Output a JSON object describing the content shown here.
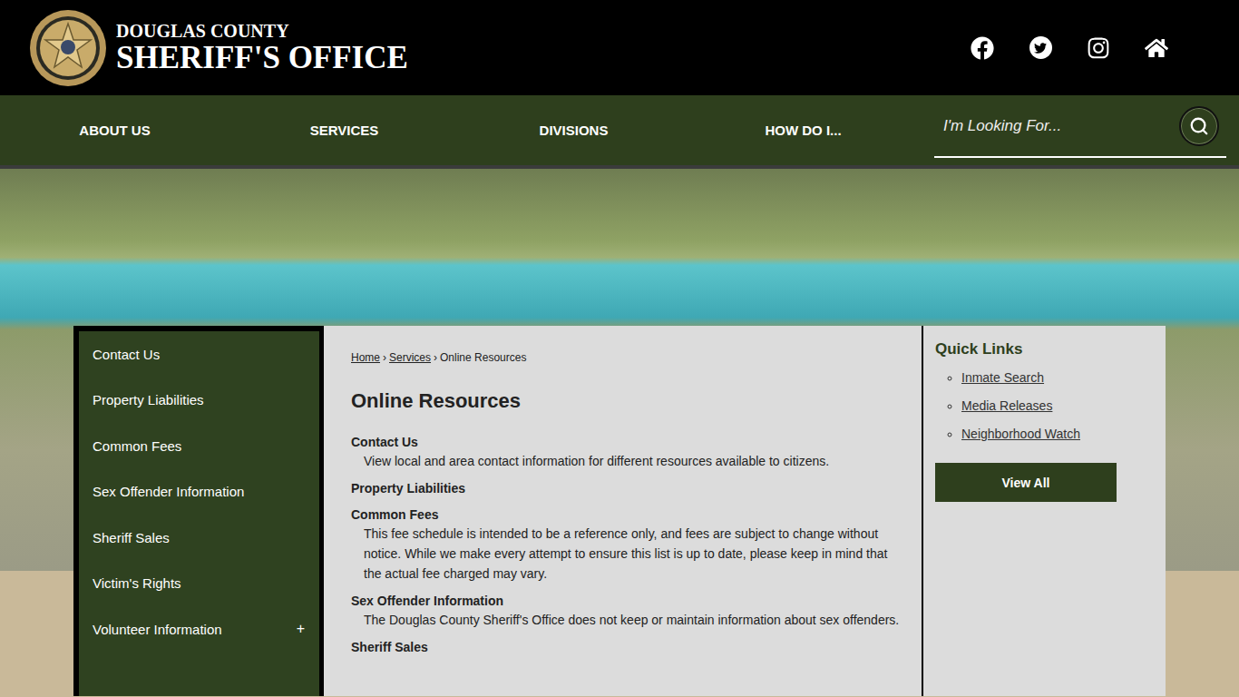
{
  "header": {
    "agency_line": "DOUGLAS COUNTY",
    "office_line": "SHERIFF'S OFFICE",
    "social": [
      {
        "kind": "facebook"
      },
      {
        "kind": "twitter"
      },
      {
        "kind": "instagram"
      },
      {
        "kind": "home"
      }
    ]
  },
  "nav": {
    "items": [
      "ABOUT US",
      "SERVICES",
      "DIVISIONS",
      "HOW DO I..."
    ],
    "search": {
      "placeholder": "I'm Looking For..."
    }
  },
  "sidebar": {
    "items": [
      {
        "label": "Contact Us",
        "toggle": ""
      },
      {
        "label": "Property Liabilities",
        "toggle": ""
      },
      {
        "label": "Common Fees",
        "toggle": ""
      },
      {
        "label": "Sex Offender Information",
        "toggle": ""
      },
      {
        "label": "Sheriff Sales",
        "toggle": ""
      },
      {
        "label": "Victim's Rights",
        "toggle": ""
      },
      {
        "label": "Volunteer Information",
        "toggle": "+"
      }
    ]
  },
  "breadcrumb": {
    "items": [
      "Home",
      "Services",
      "Online Resources"
    ],
    "separator": "›"
  },
  "page": {
    "title": "Online Resources",
    "resources": [
      {
        "title": "Contact Us",
        "description": "View local and area contact information for different resources available to citizens."
      },
      {
        "title": "Property Liabilities",
        "description": ""
      },
      {
        "title": "Common Fees",
        "description": "This fee schedule is intended to be a reference only, and fees are subject to change without notice. While we make every attempt to ensure this list is up to date, please keep in mind that the actual fee charged may vary."
      },
      {
        "title": "Sex Offender Information",
        "description": "The Douglas County Sheriff's Office does not keep or maintain information about sex offenders."
      },
      {
        "title": "Sheriff Sales",
        "description": ""
      }
    ]
  },
  "quick_links": {
    "title": "Quick Links",
    "links": [
      "Inmate Search",
      "Media Releases",
      "Neighborhood Watch"
    ],
    "button": "View All"
  }
}
